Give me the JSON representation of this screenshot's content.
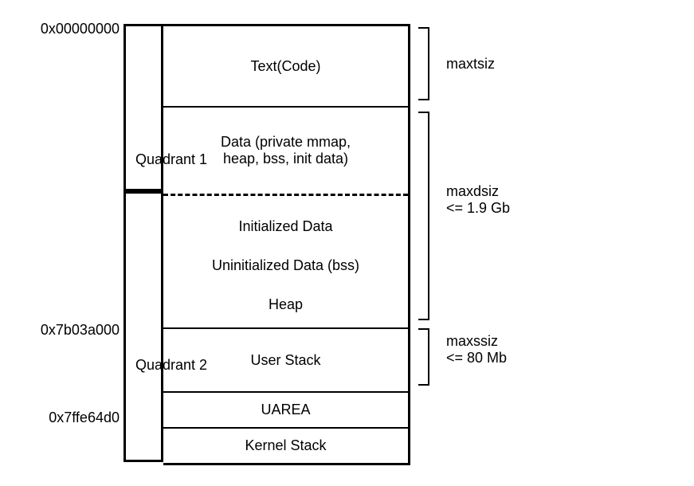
{
  "addresses": {
    "a0": "0x00000000",
    "a1": "0x7b03a000",
    "a2": "0x7ffe64d0"
  },
  "quadrants": {
    "q1": "Quadrant 1",
    "q2": "Quadrant 2"
  },
  "segments": {
    "text": "Text(Code)",
    "data_line1": "Data (private mmap,",
    "data_line2": "heap, bss, init data)",
    "init_data": "Initialized Data",
    "uninit_data": "Uninitialized Data (bss)",
    "heap": "Heap",
    "user_stack": "User Stack",
    "uarea": "UAREA",
    "kernel_stack": "Kernel Stack"
  },
  "limits": {
    "maxtsiz": "maxtsiz",
    "maxdsiz_line1": "maxdsiz",
    "maxdsiz_line2": "<= 1.9 Gb",
    "maxssiz_line1": "maxssiz",
    "maxssiz_line2": "<= 80 Mb"
  }
}
